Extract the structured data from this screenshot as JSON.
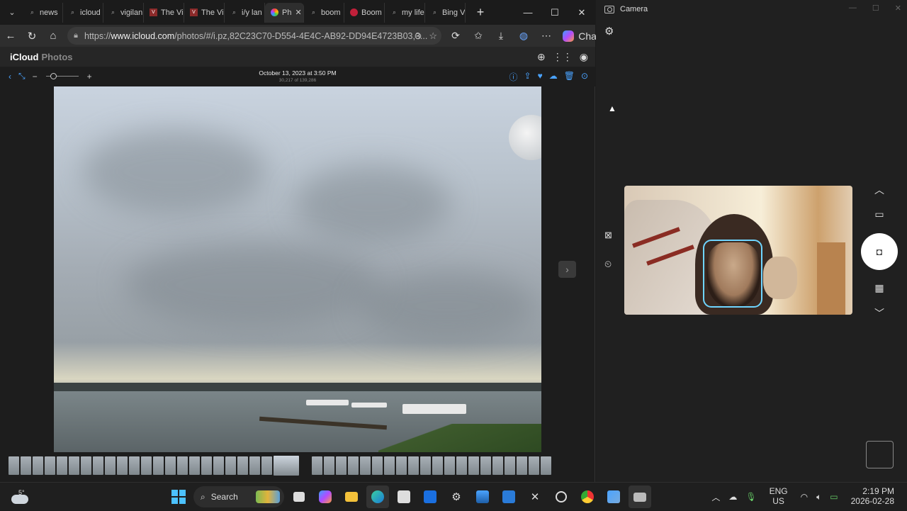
{
  "browser": {
    "tabs": [
      {
        "label": "news",
        "icon": "search-icon"
      },
      {
        "label": "icloud",
        "icon": "search-icon"
      },
      {
        "label": "vigilan",
        "icon": "search-icon"
      },
      {
        "label": "The Vi",
        "icon": "vi-favicon"
      },
      {
        "label": "The Vi",
        "icon": "vi-favicon"
      },
      {
        "label": "i/y lan",
        "icon": "search-icon"
      },
      {
        "label": "Ph",
        "icon": "photos-favicon",
        "active": true
      },
      {
        "label": "boom",
        "icon": "search-icon"
      },
      {
        "label": "Boom",
        "icon": "record-favicon"
      },
      {
        "label": "my life",
        "icon": "search-icon"
      },
      {
        "label": "Bing V",
        "icon": "search-icon"
      }
    ],
    "url_prefix": "https://",
    "url_domain": "www.icloud.com",
    "url_path": "/photos/#/i.pz,82C23C70-D554-4E4C-AB92-DD94E4723B03,3...",
    "chat_label": "Chat"
  },
  "icloud": {
    "brand": "iCloud",
    "section": "Photos",
    "photo_title": "October 13, 2023 at 3:50 PM",
    "photo_count": "30,217 of 139,286"
  },
  "camera": {
    "title": "Camera"
  },
  "taskbar": {
    "temperature": "5°",
    "search_label": "Search",
    "lang_line1": "ENG",
    "lang_line2": "US",
    "time": "2:19 PM",
    "date": "2026-02-28"
  },
  "colors": {
    "accent": "#4aa3ff",
    "face_box": "#6fd5ff"
  }
}
